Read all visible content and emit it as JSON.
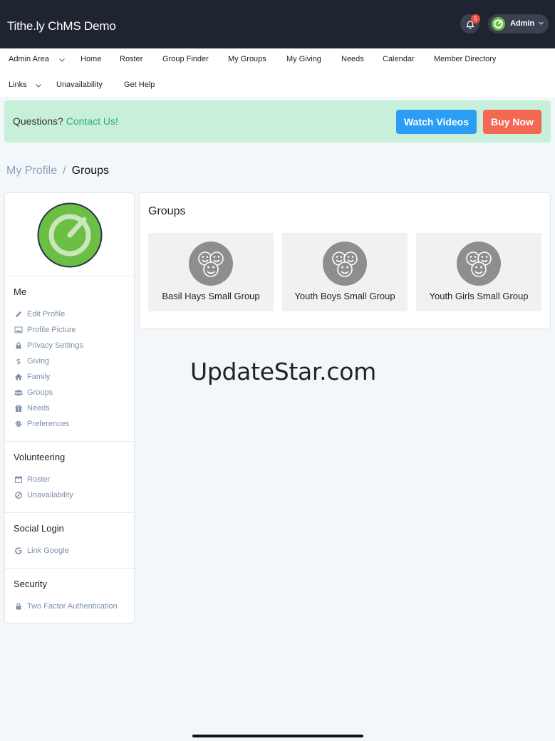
{
  "app": {
    "title": "Tithe.ly ChMS Demo"
  },
  "header": {
    "notification_count": "5",
    "user_label": "Admin"
  },
  "nav": {
    "row1": [
      "Admin Area",
      "Home",
      "Roster",
      "Group Finder",
      "My Groups",
      "My Giving",
      "Needs",
      "Calendar",
      "Member Directory"
    ],
    "row2": [
      "Links",
      "Unavailability",
      "Get Help"
    ]
  },
  "banner": {
    "question": "Questions?",
    "contact_link": "Contact Us!",
    "watch_label": "Watch Videos",
    "buy_label": "Buy Now"
  },
  "breadcrumb": {
    "parent": "My Profile",
    "separator": "/",
    "current": "Groups"
  },
  "sidebar": {
    "sections": [
      {
        "title": "Me",
        "items": [
          {
            "label": "Edit Profile",
            "icon": "pencil-icon"
          },
          {
            "label": "Profile Picture",
            "icon": "image-icon"
          },
          {
            "label": "Privacy Settings",
            "icon": "lock-icon"
          },
          {
            "label": "Giving",
            "icon": "dollar-icon"
          },
          {
            "label": "Family",
            "icon": "home-icon"
          },
          {
            "label": "Groups",
            "icon": "users-icon"
          },
          {
            "label": "Needs",
            "icon": "gift-icon"
          },
          {
            "label": "Preferences",
            "icon": "gear-icon"
          }
        ]
      },
      {
        "title": "Volunteering",
        "items": [
          {
            "label": "Roster",
            "icon": "calendar-icon"
          },
          {
            "label": "Unavailability",
            "icon": "ban-icon"
          }
        ]
      },
      {
        "title": "Social Login",
        "items": [
          {
            "label": "Link Google",
            "icon": "google-icon"
          }
        ]
      },
      {
        "title": "Security",
        "items": [
          {
            "label": "Two Factor Authentication",
            "icon": "lock-icon"
          }
        ]
      }
    ]
  },
  "groups": {
    "title": "Groups",
    "items": [
      {
        "name": "Basil Hays Small Group"
      },
      {
        "name": "Youth Boys Small Group"
      },
      {
        "name": "Youth Girls Small Group"
      }
    ]
  },
  "watermark": "UpdateStar.com",
  "colors": {
    "topbar": "#1f2431",
    "brand_green": "#6bbf45",
    "banner_bg": "#c7efd9",
    "watch_btn": "#2a9df4",
    "buy_btn": "#f26853",
    "link_green": "#25b36b"
  }
}
